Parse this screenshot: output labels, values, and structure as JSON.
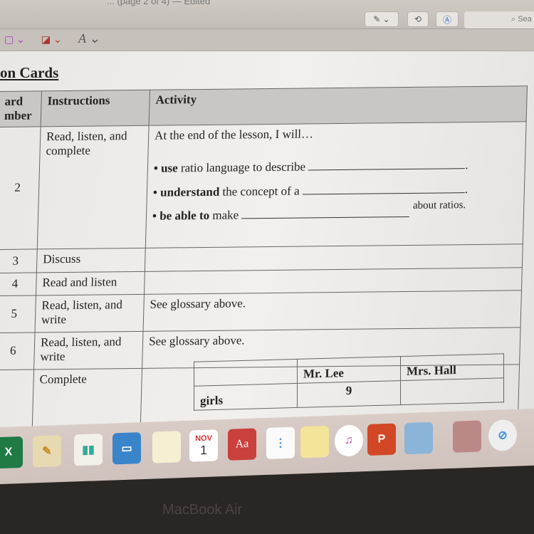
{
  "window": {
    "title": "... (page 2 of 4) — Edited"
  },
  "toolbar": {
    "pen_icon": "pen-icon",
    "chevron": "⌄",
    "search_placeholder": "Sea"
  },
  "markup_bar": {
    "shape_border": "▢ ⌄",
    "fill": "◪ ⌄",
    "text_style": "A ⌄"
  },
  "document": {
    "heading": "on Cards",
    "columns": [
      "ard mber",
      "Instructions",
      "Activity"
    ],
    "rows": [
      {
        "number": "2",
        "instructions": "Read, listen, and complete",
        "activity_intro": "At the end of the lesson, I will…",
        "bullets": [
          {
            "bold": "use",
            "text": "ratio language to describe"
          },
          {
            "bold": "understand",
            "text": "the concept of a"
          },
          {
            "bold": "be able to",
            "text": "make",
            "suffix": "about ratios."
          }
        ]
      },
      {
        "number": "3",
        "instructions": "Discuss",
        "activity": ""
      },
      {
        "number": "4",
        "instructions": "Read and listen",
        "activity": ""
      },
      {
        "number": "5",
        "instructions": "Read, listen, and write",
        "activity": "See glossary above."
      },
      {
        "number": "6",
        "instructions": "Read, listen, and write",
        "activity": "See glossary above."
      },
      {
        "number": "",
        "instructions": "Complete",
        "activity": ""
      }
    ],
    "sub_table": {
      "headers": [
        "",
        "Mr. Lee",
        "Mrs. Hall"
      ],
      "rows": [
        [
          "girls",
          "9",
          ""
        ]
      ]
    }
  },
  "dock": {
    "apps": [
      "Excel",
      "Pages",
      "Numbers",
      "Keynote",
      "Notes",
      "Calendar",
      "Dictionary",
      "Reminders",
      "Stickies",
      "iTunes",
      "PowerPoint",
      "Preview",
      "Photos",
      "Safari"
    ],
    "calendar_month": "NOV",
    "calendar_day": "1",
    "dictionary_label": "Aa"
  },
  "laptop": {
    "brand": "MacBook Air"
  }
}
